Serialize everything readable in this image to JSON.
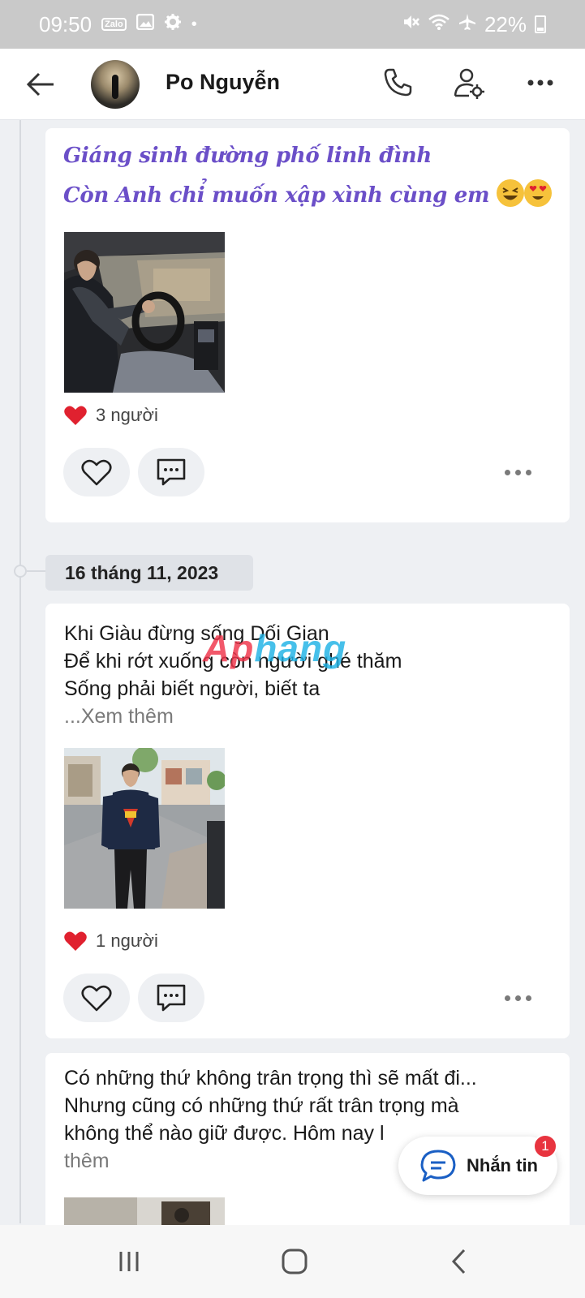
{
  "status_bar": {
    "time": "09:50",
    "zalo": "Zalo",
    "battery": "22%"
  },
  "header": {
    "title": "Po Nguyễn"
  },
  "posts": [
    {
      "lines": [
        "Giáng sinh đường phố linh đình",
        "Còn Anh chỉ muốn xập xình cùng em"
      ],
      "likes": "3 người"
    },
    {
      "date": "16 tháng 11, 2023",
      "lines": [
        "Khi Giàu đừng sống Dối Gian",
        "Để khi rớt xuống còn người ghé thăm",
        "Sống phải biết người, biết ta"
      ],
      "see_more": "...Xem thêm",
      "likes": "1 người"
    },
    {
      "lines": [
        "Có những thứ không trân trọng thì sẽ mất đi...",
        "Nhưng cũng có những thứ rất trân trọng mà",
        "không thể nào giữ được. Hôm nay l"
      ],
      "see_more_tail": "thêm"
    }
  ],
  "watermark": {
    "part_a": "Ap",
    "part_b": "hang"
  },
  "message_button": {
    "label": "Nhắn tin",
    "badge": "1"
  },
  "colors": {
    "accent_purple": "#6b4fc8",
    "heart_red": "#e0212f",
    "badge_red": "#e8343f"
  }
}
